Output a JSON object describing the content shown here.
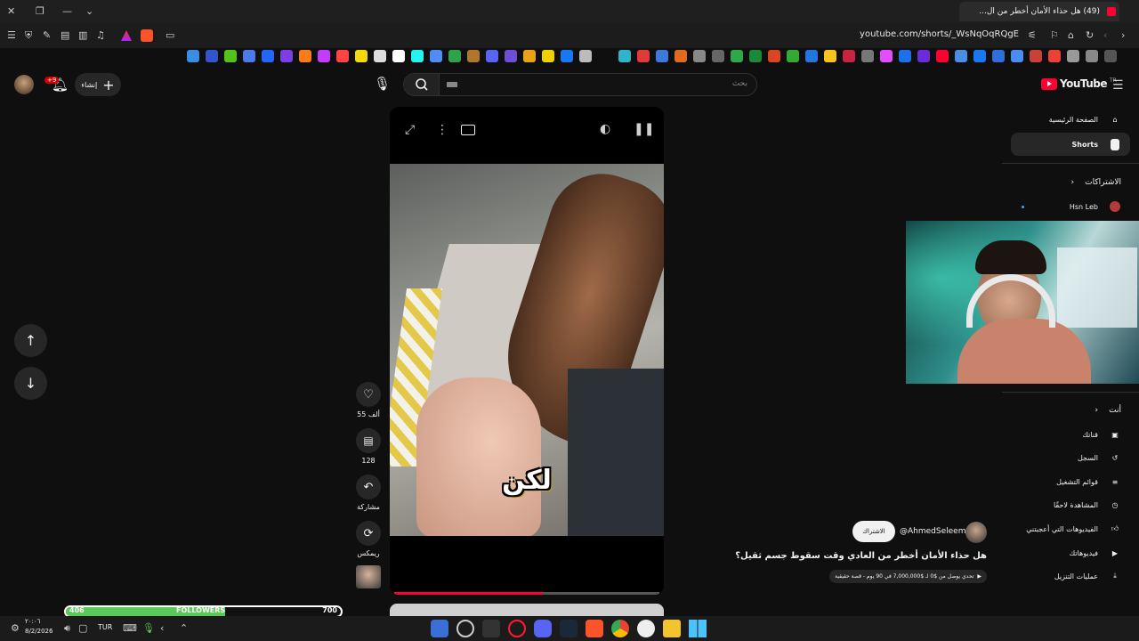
{
  "browser": {
    "tab_title": "(49) هل حذاء الأمان أخطر من ال...",
    "url": "youtube.com/shorts/_WsNqOqRQgE"
  },
  "header": {
    "create_label": "إنشاء",
    "notifications_badge": "+9",
    "search_placeholder": "بحث",
    "logo_text": "YouTube",
    "logo_region": "TR"
  },
  "sidebar": {
    "items": [
      {
        "label": "الصفحة الرئيسية",
        "icon": "home-icon"
      },
      {
        "label": "Shorts",
        "icon": "shorts-icon"
      }
    ],
    "subscriptions_title": "الاشتراكات",
    "subscriptions": [
      {
        "label": "Hsn Leb"
      }
    ],
    "you_title": "أنت",
    "you_items": [
      {
        "label": "قناتك",
        "icon": "channel-icon"
      },
      {
        "label": "السجل",
        "icon": "history-icon"
      },
      {
        "label": "قوائم التشغيل",
        "icon": "playlist-icon"
      },
      {
        "label": "المشاهدة لاحقًا",
        "icon": "clock-icon"
      },
      {
        "label": "الفيديوهات التي أعجبتني",
        "icon": "like-icon"
      },
      {
        "label": "فيديوهاتك",
        "icon": "video-icon"
      },
      {
        "label": "عمليات التنزيل",
        "icon": "download-icon"
      }
    ]
  },
  "video": {
    "caption": "لكن",
    "progress": 0.56
  },
  "actions": {
    "likes": "55 ألف",
    "comments": "128",
    "share": "مشاركة",
    "remix": "ريمكس"
  },
  "meta": {
    "channel": "@AhmedSeleem",
    "subscribe": "الاشتراك",
    "title": "هل حذاء الأمان أخطر من العادي وقت سقوط جسم ثقيل؟",
    "related": "تحدي يوصل من $0 لـ $7,000,000 في 90 يوم - قصة حقيقية"
  },
  "overlay": {
    "followers_label": "FOLLOWERS",
    "followers_current": "406",
    "followers_goal": "700",
    "followers_progress": 0.58
  },
  "taskbar": {
    "time": "٢٠:٠٦",
    "date": "8/2/2026",
    "lang": "TUR"
  },
  "colors": {
    "background": "#0f0f0f",
    "accent_red": "#ff0033",
    "follower_green": "#5ac85a"
  }
}
